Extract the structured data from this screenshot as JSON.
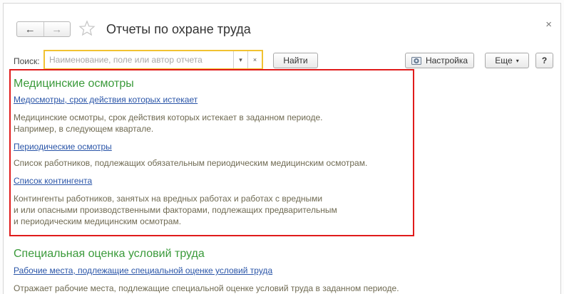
{
  "window": {
    "title": "Отчеты по охране труда",
    "close_glyph": "×",
    "back_glyph": "←",
    "forward_glyph": "→"
  },
  "toolbar": {
    "search_label": "Поиск:",
    "search_placeholder": "Наименование, поле или автор отчета",
    "dropdown_glyph": "▾",
    "clear_glyph": "×",
    "find_label": "Найти",
    "settings_label": "Настройка",
    "more_label": "Еще",
    "more_caret": "▾",
    "help_label": "?"
  },
  "colors": {
    "group_title": "#3a9a3a",
    "link": "#2a55a8",
    "description": "#6f6a52",
    "highlight_border": "#e01b1b",
    "search_border": "#f1c232"
  },
  "groups": [
    {
      "title": "Медицинские осмотры",
      "reports": [
        {
          "link": "Медосмотры, срок действия которых истекает",
          "description": "Медицинские осмотры, срок действия которых истекает в заданном периоде.\nНапример, в следующем квартале."
        },
        {
          "link": "Периодические осмотры",
          "description": "Список работников, подлежащих обязательным периодическим медицинским осмотрам."
        },
        {
          "link": "Список контингента",
          "description": "Контингенты работников, занятых на вредных работах и работах с вредными\nи или опасными производственными факторами, подлежащих предварительным\nи периодическим медицинским осмотрам."
        }
      ]
    },
    {
      "title": "Специальная оценка условий труда",
      "reports": [
        {
          "link": "Рабочие места, подлежащие специальной оценке условий труда",
          "description": "Отражает рабочие места, подлежащие специальной оценке условий труда в заданном периоде."
        }
      ]
    }
  ]
}
